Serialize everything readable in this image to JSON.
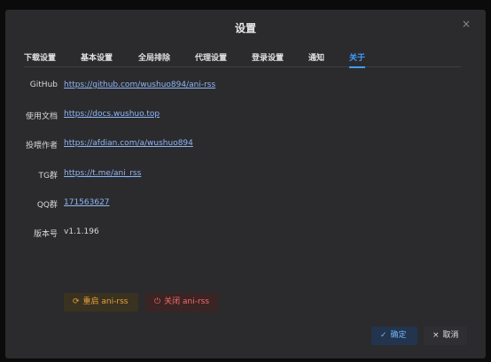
{
  "dialog": {
    "title": "设置",
    "close_glyph": "×"
  },
  "tabs": [
    {
      "label": "下载设置"
    },
    {
      "label": "基本设置"
    },
    {
      "label": "全局排除"
    },
    {
      "label": "代理设置"
    },
    {
      "label": "登录设置"
    },
    {
      "label": "通知"
    },
    {
      "label": "关于",
      "active": true
    }
  ],
  "about": {
    "rows": [
      {
        "label": "GitHub",
        "value": "https://github.com/wushuo894/ani-rss",
        "is_link": true
      },
      {
        "label": "使用文档",
        "value": "https://docs.wushuo.top",
        "is_link": true
      },
      {
        "label": "投喂作者",
        "value": "https://afdian.com/a/wushuo894",
        "is_link": true
      },
      {
        "label": "TG群",
        "value": "https://t.me/ani_rss",
        "is_link": true
      },
      {
        "label": "QQ群",
        "value": "171563627",
        "is_link": true
      },
      {
        "label": "版本号",
        "value": "v1.1.196",
        "is_link": false
      }
    ]
  },
  "actions": {
    "restart_label": "重启 ani-rss",
    "restart_icon": "refresh-icon",
    "shutdown_label": "关闭 ani-rss",
    "shutdown_icon": "power-icon"
  },
  "footer": {
    "confirm_label": "确定",
    "confirm_icon": "check-icon",
    "cancel_label": "取消",
    "cancel_icon": "close-icon"
  },
  "colors": {
    "accent": "#409eff",
    "warning": "#e6a23c",
    "danger": "#f56c6c",
    "link": "#8fb5f5"
  }
}
